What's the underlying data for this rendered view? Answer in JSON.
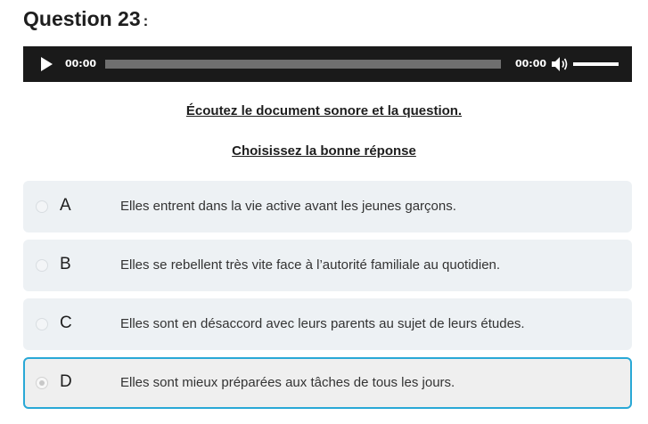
{
  "question": {
    "title": "Question 23",
    "colon": ":"
  },
  "audio_player": {
    "current_time": "00:00",
    "duration": "00:00",
    "progress": 0,
    "volume": 1.0,
    "play_icon": "play-icon",
    "volume_icon": "speaker-icon"
  },
  "instructions": {
    "listen": "Écoutez le document sonore et la question.",
    "choose": "Choisissez la bonne réponse"
  },
  "options": [
    {
      "letter": "A",
      "text": "Elles entrent dans la vie active avant les jeunes garçons."
    },
    {
      "letter": "B",
      "text": "Elles se rebellent très vite face à l’autorité familiale au quotidien."
    },
    {
      "letter": "C",
      "text": "Elles sont en désaccord avec leurs parents au sujet de leurs études."
    },
    {
      "letter": "D",
      "text": "Elles sont mieux préparées aux tâches de tous les jours."
    }
  ],
  "selected_option": "D",
  "colors": {
    "accent": "#29a8d6",
    "option_bg": "#edf1f4",
    "player_bg": "#1a1a1a"
  }
}
